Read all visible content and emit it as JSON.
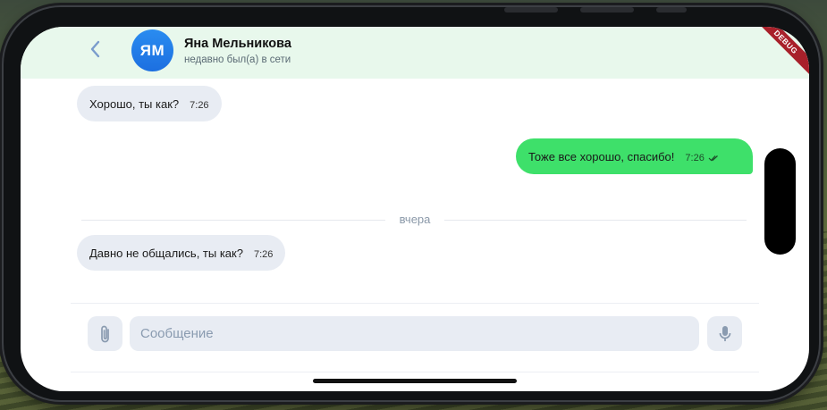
{
  "contact": {
    "initials": "ЯМ",
    "name": "Яна Мельникова",
    "status": "недавно был(а) в сети"
  },
  "debug_banner": "DEBUG",
  "messages": [
    {
      "direction": "in",
      "text": "Хорошо, ты как?",
      "time": "7:26"
    },
    {
      "direction": "out",
      "text": "Тоже все хорошо, спасибо!",
      "time": "7:26",
      "read": true
    },
    {
      "direction": "in",
      "text": "Давно не общались, ты как?",
      "time": "7:26"
    }
  ],
  "date_divider": "вчера",
  "composer": {
    "placeholder": "Сообщение",
    "value": ""
  },
  "icons": {
    "back": "chevron-left-icon",
    "attach": "paperclip-icon",
    "mic": "microphone-icon",
    "read": "double-check-icon"
  },
  "colors": {
    "header_bg": "#e8f8ec",
    "avatar": "#1c6fe0",
    "outgoing_bubble": "#3ee06a",
    "incoming_bubble": "#e8ecf3",
    "accent_icon": "#7a9ccc"
  }
}
